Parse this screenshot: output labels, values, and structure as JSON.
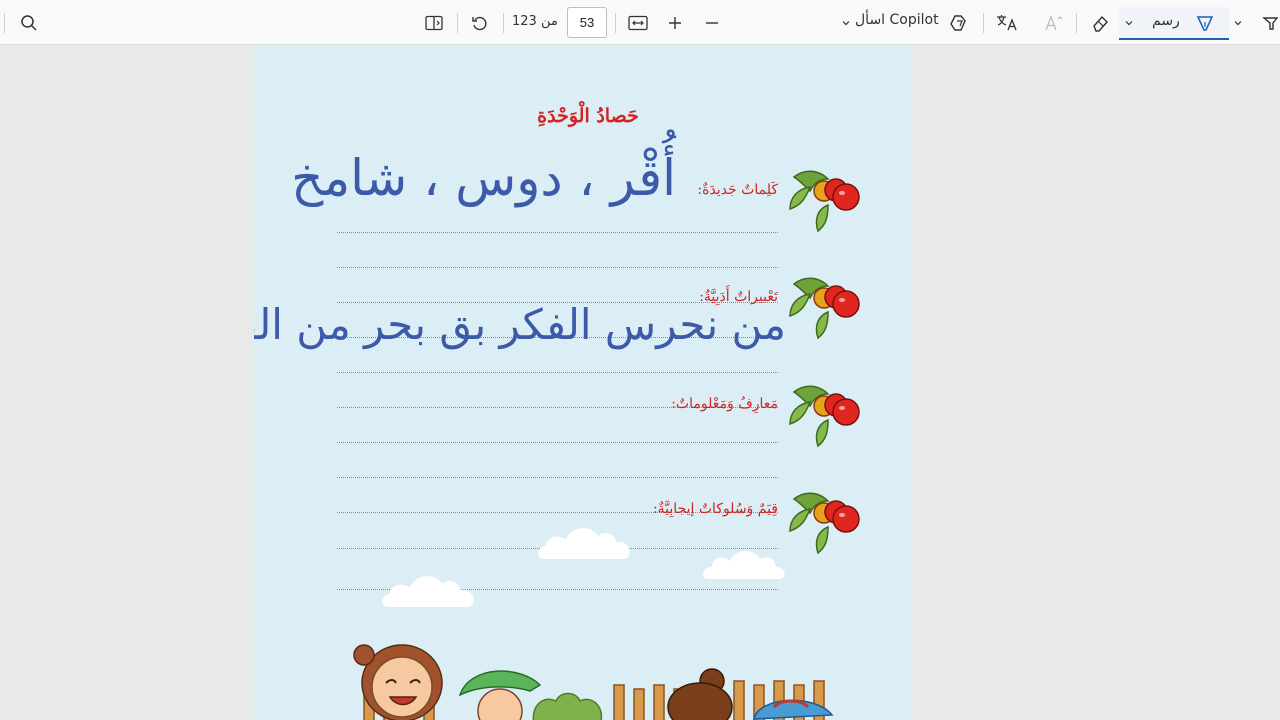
{
  "toolbar": {
    "page_number": "53",
    "page_total": "من 123",
    "copilot_label": "اسأل Copilot",
    "draw_label": "رسم",
    "icons": [
      "search-icon",
      "sidebar-icon",
      "rotate-icon",
      "fit-width-icon",
      "zoom-in-icon",
      "zoom-out-icon",
      "chevron-down-icon",
      "copilot-icon",
      "translate-icon",
      "read-aloud-icon",
      "eraser-icon",
      "pen-icon",
      "highlighter-icon"
    ],
    "accent_color": "#1a5fb4"
  },
  "document": {
    "title": "حَصادُ الْوَحْدَةِ",
    "sections": [
      {
        "label": "كَلِماتٌ جَديدَةٌ:",
        "handwriting": "أُقْر ، دوس ، شامخ"
      },
      {
        "label": "تَعْبيراتٌ أَدَبِيَّةٌ:",
        "handwriting": "من نحرس الفكر بق بحر من الفلو"
      },
      {
        "label": "مَعارِفُ وَمَعْلوماتٌ:",
        "handwriting": ""
      },
      {
        "label": "قِيَمٌ وَسُلوكاتٌ إيجابِيَّةٌ:",
        "handwriting": ""
      }
    ],
    "colors": {
      "heading": "#cf2424",
      "handwriting": "#3c5aa8",
      "page_bg": "#dbeef5"
    }
  }
}
